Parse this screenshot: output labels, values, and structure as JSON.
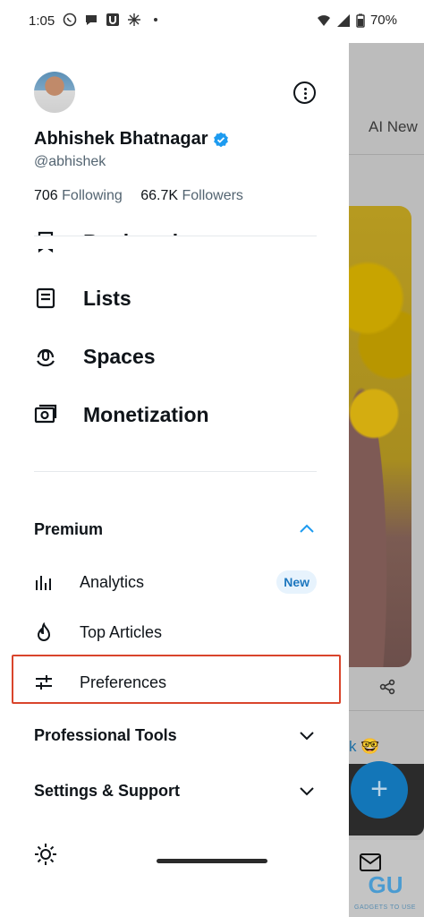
{
  "status_bar": {
    "time": "1:05",
    "battery": "70%"
  },
  "profile": {
    "name": "Abhishek Bhatnagar",
    "handle": "@abhishek",
    "following_count": "706",
    "following_label": "Following",
    "followers_count": "66.7K",
    "followers_label": "Followers"
  },
  "nav": {
    "items": [
      {
        "label": "Bookmarks",
        "icon": "bookmark-icon"
      },
      {
        "label": "Lists",
        "icon": "list-icon"
      },
      {
        "label": "Spaces",
        "icon": "spaces-icon"
      },
      {
        "label": "Monetization",
        "icon": "money-icon"
      }
    ]
  },
  "premium": {
    "label": "Premium",
    "expanded": true,
    "items": [
      {
        "label": "Analytics",
        "icon": "bar-chart-icon",
        "badge": "New"
      },
      {
        "label": "Top Articles",
        "icon": "flame-icon"
      },
      {
        "label": "Preferences",
        "icon": "sliders-icon",
        "highlighted": true
      }
    ]
  },
  "professional_tools": {
    "label": "Professional Tools"
  },
  "settings_support": {
    "label": "Settings & Support"
  },
  "background_feed": {
    "tab_label": "AI New",
    "link_text": "k 🤓",
    "watermark": "GADGETS TO USE"
  },
  "colors": {
    "accent": "#1d9bf0",
    "highlight_border": "#d9452c",
    "badge_bg": "#e7f3fd"
  }
}
